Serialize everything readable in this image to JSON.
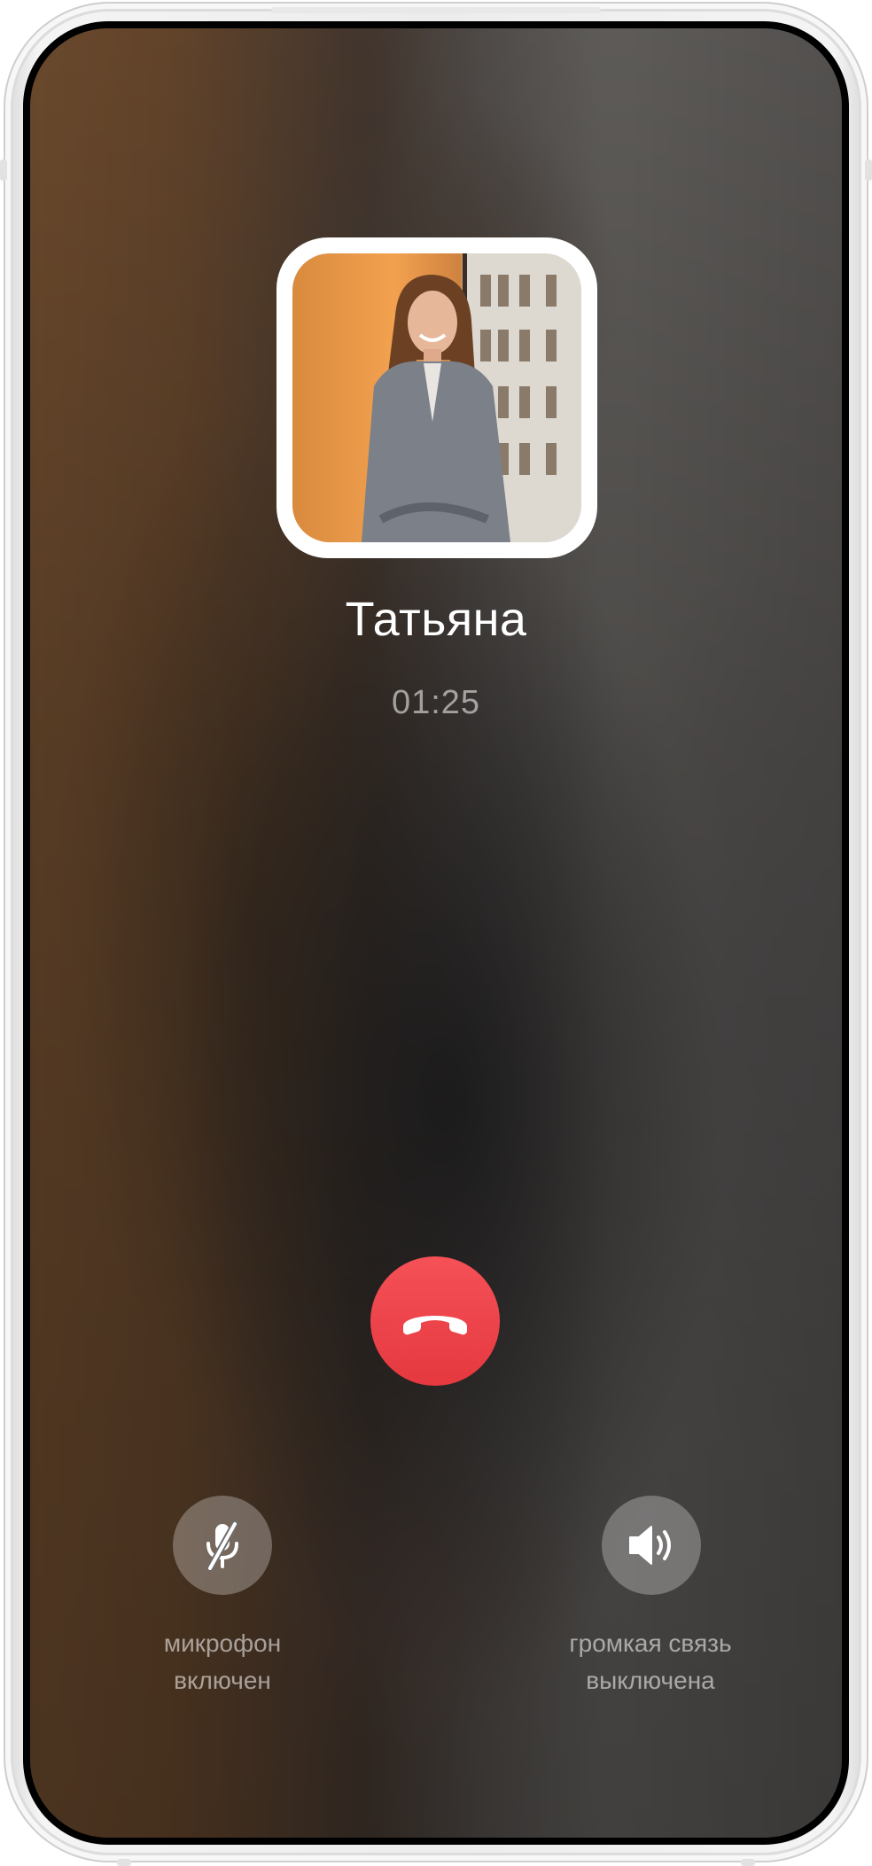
{
  "call": {
    "contact_name": "Татьяна",
    "duration": "01:25"
  },
  "controls": {
    "end_call_icon": "phone-hangup-icon",
    "microphone": {
      "icon": "microphone-muted-icon",
      "label_line1": "микрофон",
      "label_line2": "включен"
    },
    "speaker": {
      "icon": "speaker-icon",
      "label_line1": "громкая связь",
      "label_line2": "выключена"
    }
  },
  "colors": {
    "end_call": "#e8434a",
    "text_primary": "#ffffff",
    "text_secondary": "rgba(255,255,255,0.55)"
  }
}
